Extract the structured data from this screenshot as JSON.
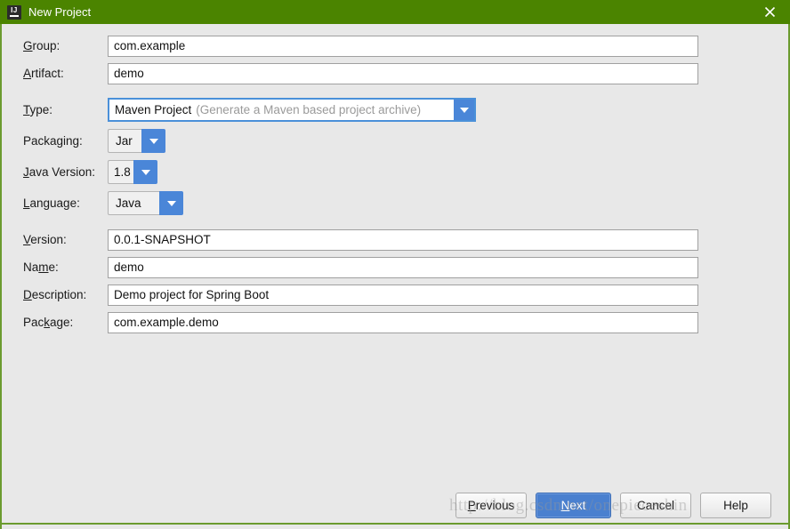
{
  "window": {
    "title": "New Project",
    "icon": "intellij-idea-icon",
    "icon_text": "IJ",
    "close_icon": "close-icon",
    "titlebar_color": "#4b8400",
    "border_color": "#6b9b2f",
    "panel_color": "#e8e8e8"
  },
  "form": {
    "fields": [
      {
        "key": "group",
        "label": "Group:",
        "mnemonic": "G",
        "type": "text",
        "value": "com.example"
      },
      {
        "key": "artifact",
        "label": "Artifact:",
        "mnemonic": "A",
        "type": "text",
        "value": "demo"
      },
      {
        "key": "type",
        "label": "Type:",
        "mnemonic": "T",
        "type": "combo-wide",
        "value": "Maven Project",
        "hint": "(Generate a Maven based project archive)",
        "focused": true,
        "arrow_icon": "chevron-down-icon"
      },
      {
        "key": "packaging",
        "label": "Packaging:",
        "mnemonic": "g",
        "type": "combo-small",
        "value": "Jar",
        "arrow_icon": "chevron-down-icon"
      },
      {
        "key": "java-version",
        "label": "Java Version:",
        "mnemonic": "J",
        "type": "combo-small",
        "value": "1.8",
        "arrow_icon": "chevron-down-icon"
      },
      {
        "key": "language",
        "label": "Language:",
        "mnemonic": "L",
        "type": "combo-small",
        "value": "Java",
        "arrow_icon": "chevron-down-icon"
      },
      {
        "key": "version",
        "label": "Version:",
        "mnemonic": "V",
        "type": "text",
        "value": "0.0.1-SNAPSHOT"
      },
      {
        "key": "name",
        "label": "Name:",
        "mnemonic": "m",
        "type": "text",
        "value": "demo"
      },
      {
        "key": "description",
        "label": "Description:",
        "mnemonic": "D",
        "type": "text",
        "value": "Demo project for Spring Boot"
      },
      {
        "key": "package",
        "label": "Package:",
        "mnemonic": "k",
        "type": "text",
        "value": "com.example.demo"
      }
    ]
  },
  "buttons": {
    "previous": {
      "label": "Previous",
      "mnemonic": "P"
    },
    "next": {
      "label": "Next",
      "mnemonic": "N",
      "primary": true,
      "accent": "#4a80cf"
    },
    "cancel": {
      "label": "Cancel",
      "mnemonic": ""
    },
    "help": {
      "label": "Help",
      "mnemonic": ""
    }
  },
  "watermark": {
    "text": "http://blog.csdn.net/onepieceshin"
  }
}
